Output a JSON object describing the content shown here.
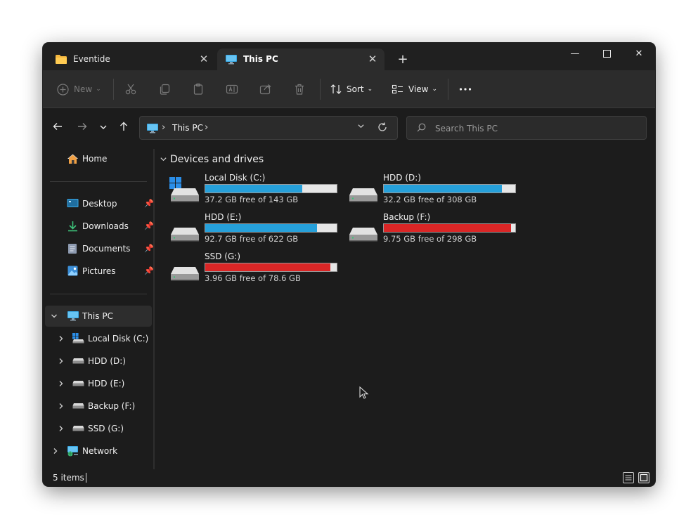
{
  "tabs": [
    {
      "label": "Eventide",
      "icon": "folder-icon",
      "active": false
    },
    {
      "label": "This PC",
      "icon": "computer-icon",
      "active": true
    }
  ],
  "toolbar": {
    "new_label": "New",
    "sort_label": "Sort",
    "view_label": "View"
  },
  "address": {
    "crumb": "This PC"
  },
  "search": {
    "placeholder": "Search This PC"
  },
  "sidebar": {
    "home": "Home",
    "quick_access": [
      {
        "label": "Desktop",
        "icon": "desktop-icon"
      },
      {
        "label": "Downloads",
        "icon": "download-icon"
      },
      {
        "label": "Documents",
        "icon": "document-icon"
      },
      {
        "label": "Pictures",
        "icon": "picture-icon"
      }
    ],
    "this_pc": "This PC",
    "drives": [
      {
        "label": "Local Disk (C:)"
      },
      {
        "label": "HDD (D:)"
      },
      {
        "label": "HDD (E:)"
      },
      {
        "label": "Backup (F:)"
      },
      {
        "label": "SSD (G:)"
      }
    ],
    "network": "Network"
  },
  "content": {
    "section_title": "Devices and drives",
    "drives": [
      {
        "name": "Local Disk (C:)",
        "free": "37.2 GB free of 143 GB",
        "used_fraction": 0.74,
        "status_color": "#26a0da"
      },
      {
        "name": "HDD (D:)",
        "free": "32.2 GB free of 308 GB",
        "used_fraction": 0.9,
        "status_color": "#26a0da"
      },
      {
        "name": "HDD (E:)",
        "free": "92.7 GB free of 622 GB",
        "used_fraction": 0.85,
        "status_color": "#26a0da"
      },
      {
        "name": "Backup (F:)",
        "free": "9.75 GB free of 298 GB",
        "used_fraction": 0.97,
        "status_color": "#da2626"
      },
      {
        "name": "SSD (G:)",
        "free": "3.96 GB free of 78.6 GB",
        "used_fraction": 0.95,
        "status_color": "#da2626"
      }
    ]
  },
  "status": {
    "item_count": "5 items"
  }
}
